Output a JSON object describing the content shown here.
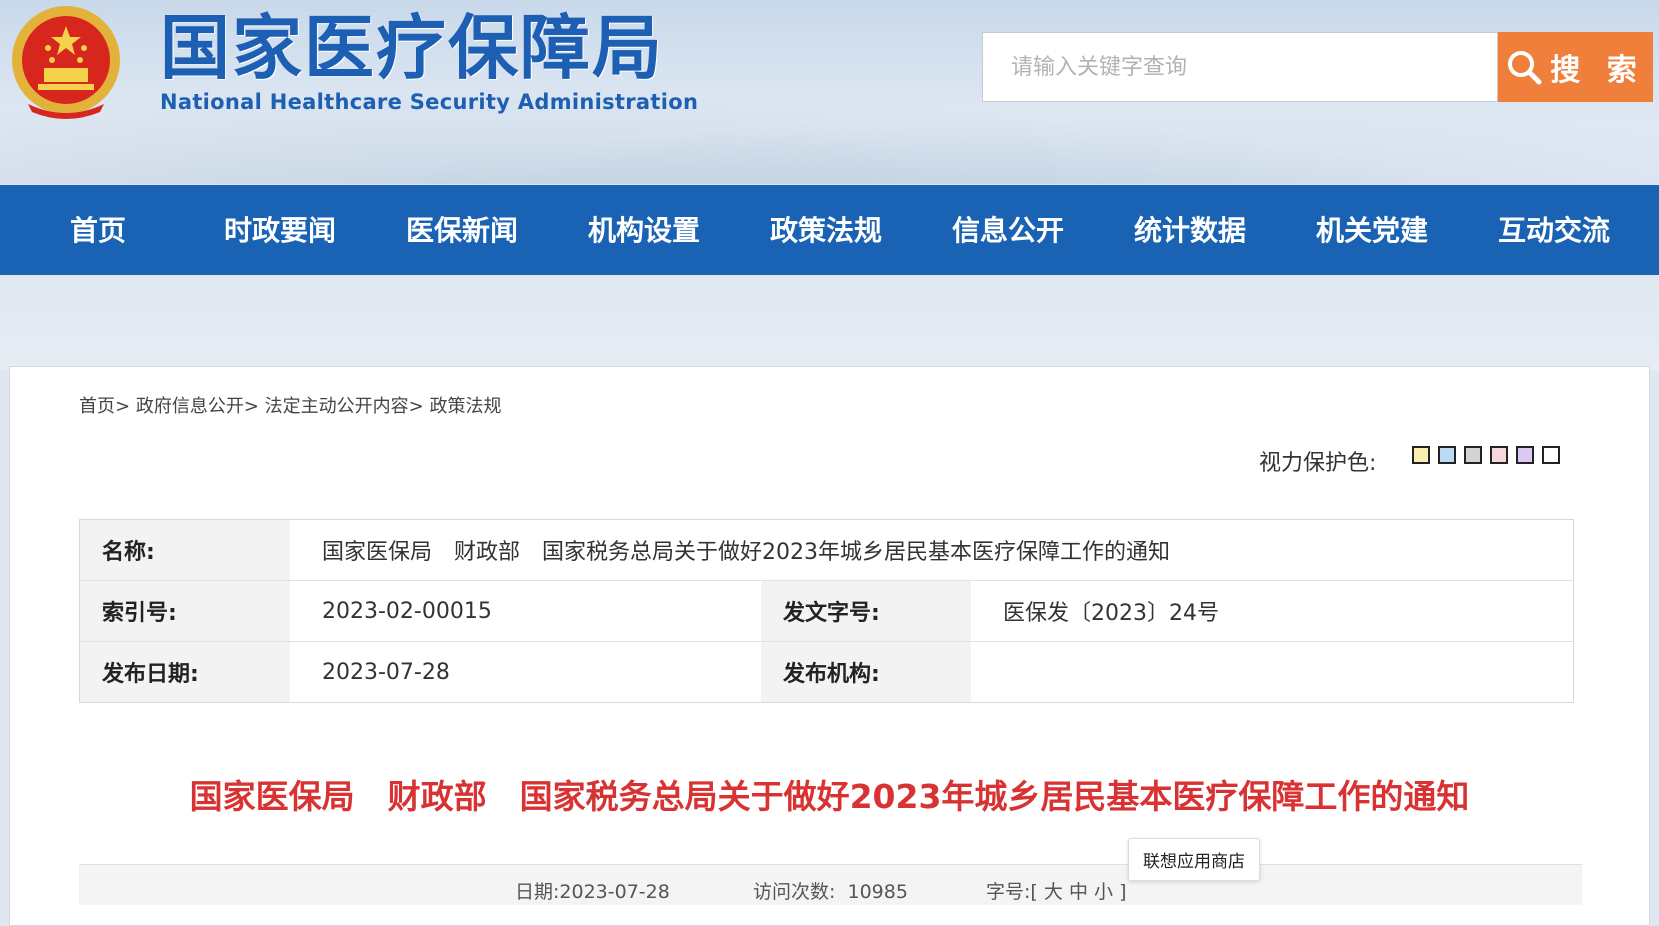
{
  "header": {
    "logo_cn": "国家医疗保障局",
    "logo_en": "National Healthcare Security Administration",
    "search_placeholder": "请输入关键字查询",
    "search_button": "搜 索"
  },
  "nav": [
    "首页",
    "时政要闻",
    "医保新闻",
    "机构设置",
    "政策法规",
    "信息公开",
    "统计数据",
    "机关党建",
    "互动交流"
  ],
  "breadcrumb": [
    "首页>",
    "政府信息公开>",
    "法定主动公开内容>",
    "政策法规"
  ],
  "eye_protect": {
    "label": "视力保护色:",
    "colors": [
      "#f8efb1",
      "#b9dcf2",
      "#d3d3d3",
      "#f7d6dc",
      "#dcc8f2",
      "#ffffff"
    ]
  },
  "meta": {
    "name_label": "名称:",
    "name_value": "国家医保局　财政部　国家税务总局关于做好2023年城乡居民基本医疗保障工作的通知",
    "index_label": "索引号:",
    "index_value": "2023-02-00015",
    "docno_label": "发文字号:",
    "docno_value": "医保发〔2023〕24号",
    "date_label": "发布日期:",
    "date_value": "2023-07-28",
    "org_label": "发布机构:",
    "org_value": ""
  },
  "title": "国家医保局　财政部　国家税务总局关于做好2023年城乡居民基本医疗保障工作的通知",
  "tooltip": "联想应用商店",
  "info": {
    "date": "日期:2023-07-28",
    "visits": "访问次数:  10985",
    "font_label": "字号:[",
    "font_large": "大",
    "font_medium": "中",
    "font_small": "小",
    "font_end": "]"
  }
}
